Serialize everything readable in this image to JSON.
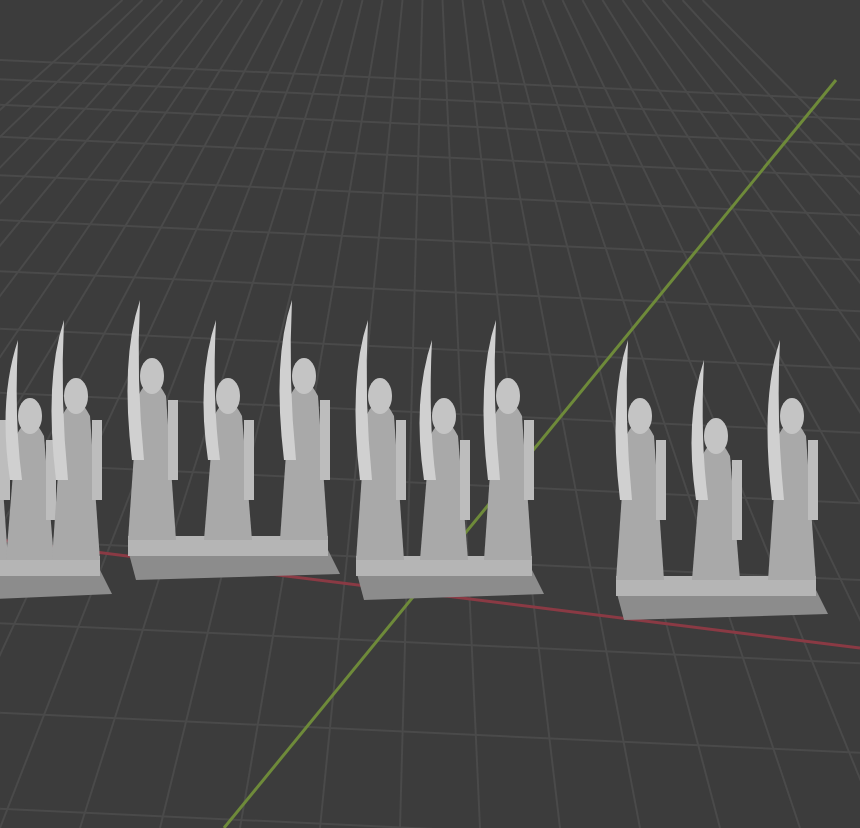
{
  "viewport": {
    "grid": true,
    "axes": [
      {
        "color": "#8a3a44"
      },
      {
        "color": "#6e8a3a"
      }
    ]
  },
  "objects": [
    {
      "kind": "miniature-unit"
    },
    {
      "kind": "miniature-unit"
    },
    {
      "kind": "miniature-unit"
    },
    {
      "kind": "miniature-unit"
    }
  ]
}
